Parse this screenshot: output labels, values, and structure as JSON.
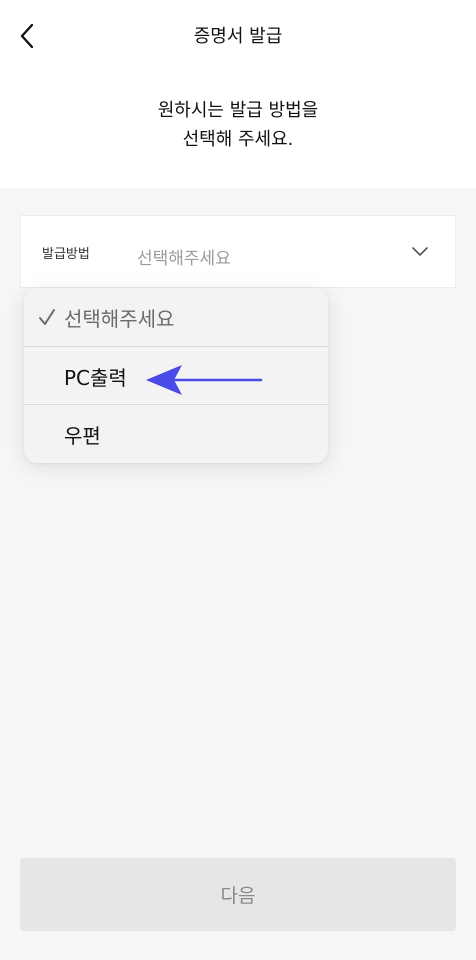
{
  "header": {
    "title": "증명서 발급",
    "back_icon": "chevron-left-icon"
  },
  "instruction": {
    "line1": "원하시는 발급 방법을",
    "line2": "선택해 주세요."
  },
  "select": {
    "label": "발급방법",
    "value": "선택해주세요",
    "chevron_icon": "chevron-down-icon"
  },
  "dropdown": {
    "options": [
      {
        "label": "선택해주세요",
        "selected": true
      },
      {
        "label": "PC출력",
        "selected": false
      },
      {
        "label": "우편",
        "selected": false
      }
    ],
    "check_icon": "checkmark-icon"
  },
  "annotation": {
    "arrow_color": "#4a4ae8"
  },
  "footer": {
    "next_label": "다음"
  }
}
